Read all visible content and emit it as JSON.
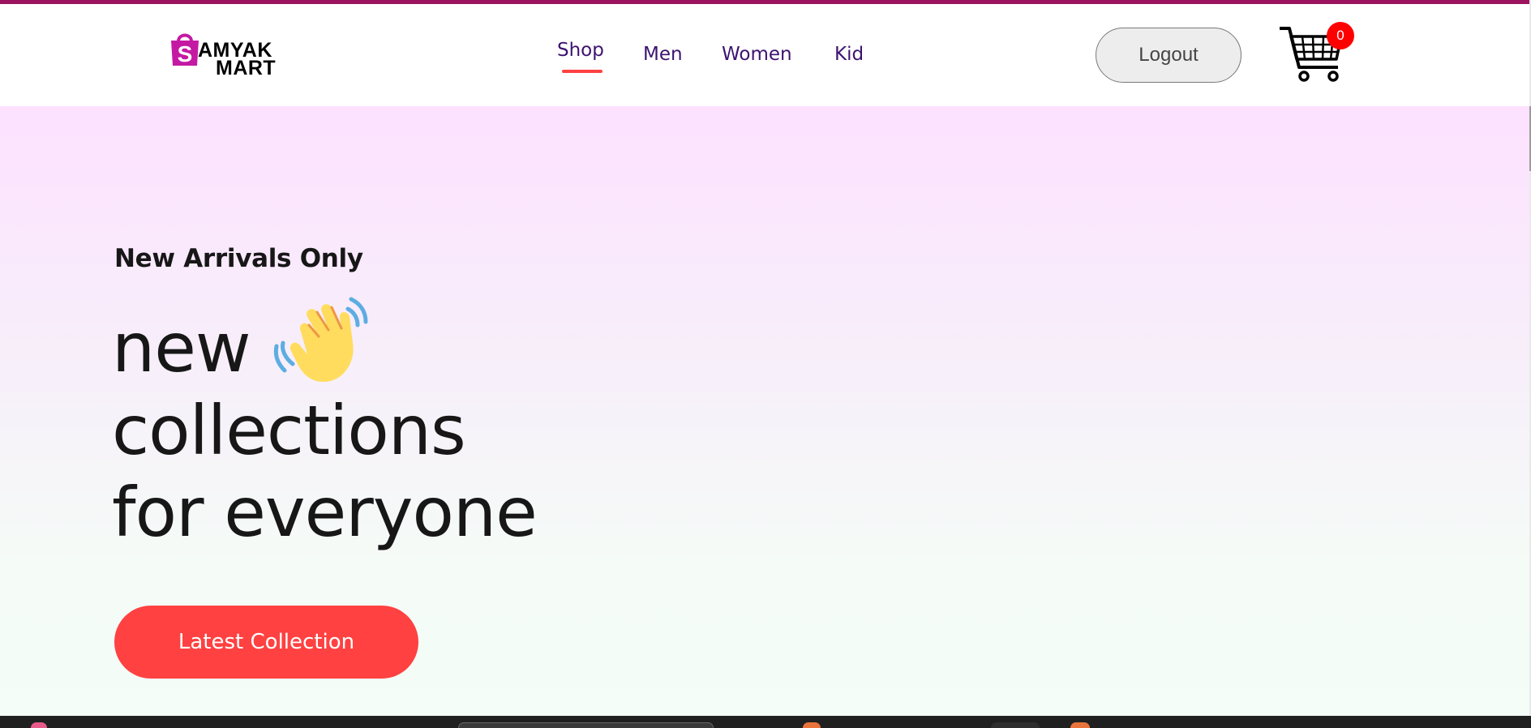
{
  "brand": {
    "logo_letter": "S",
    "logo_line1": "AMYAK",
    "logo_line2": "MART",
    "accent_color": "#c41aa3",
    "top_strip_color": "#9c1460"
  },
  "nav": {
    "items": [
      {
        "label": "Shop",
        "active": true
      },
      {
        "label": "Men",
        "active": false
      },
      {
        "label": "Women",
        "active": false
      },
      {
        "label": "Kid",
        "active": false
      }
    ],
    "text_color": "#3d1370",
    "active_indicator_color": "#ff4141"
  },
  "header": {
    "logout_label": "Logout",
    "cart_icon": "cart-icon",
    "cart_count": "0"
  },
  "hero": {
    "tagline": "New Arrivals Only",
    "title_line1": "new",
    "title_line2": "collections",
    "title_line3": "for everyone",
    "title_icon": "waving-hand-icon",
    "cta_label": "Latest Collection",
    "cta_color": "#ff4141"
  }
}
